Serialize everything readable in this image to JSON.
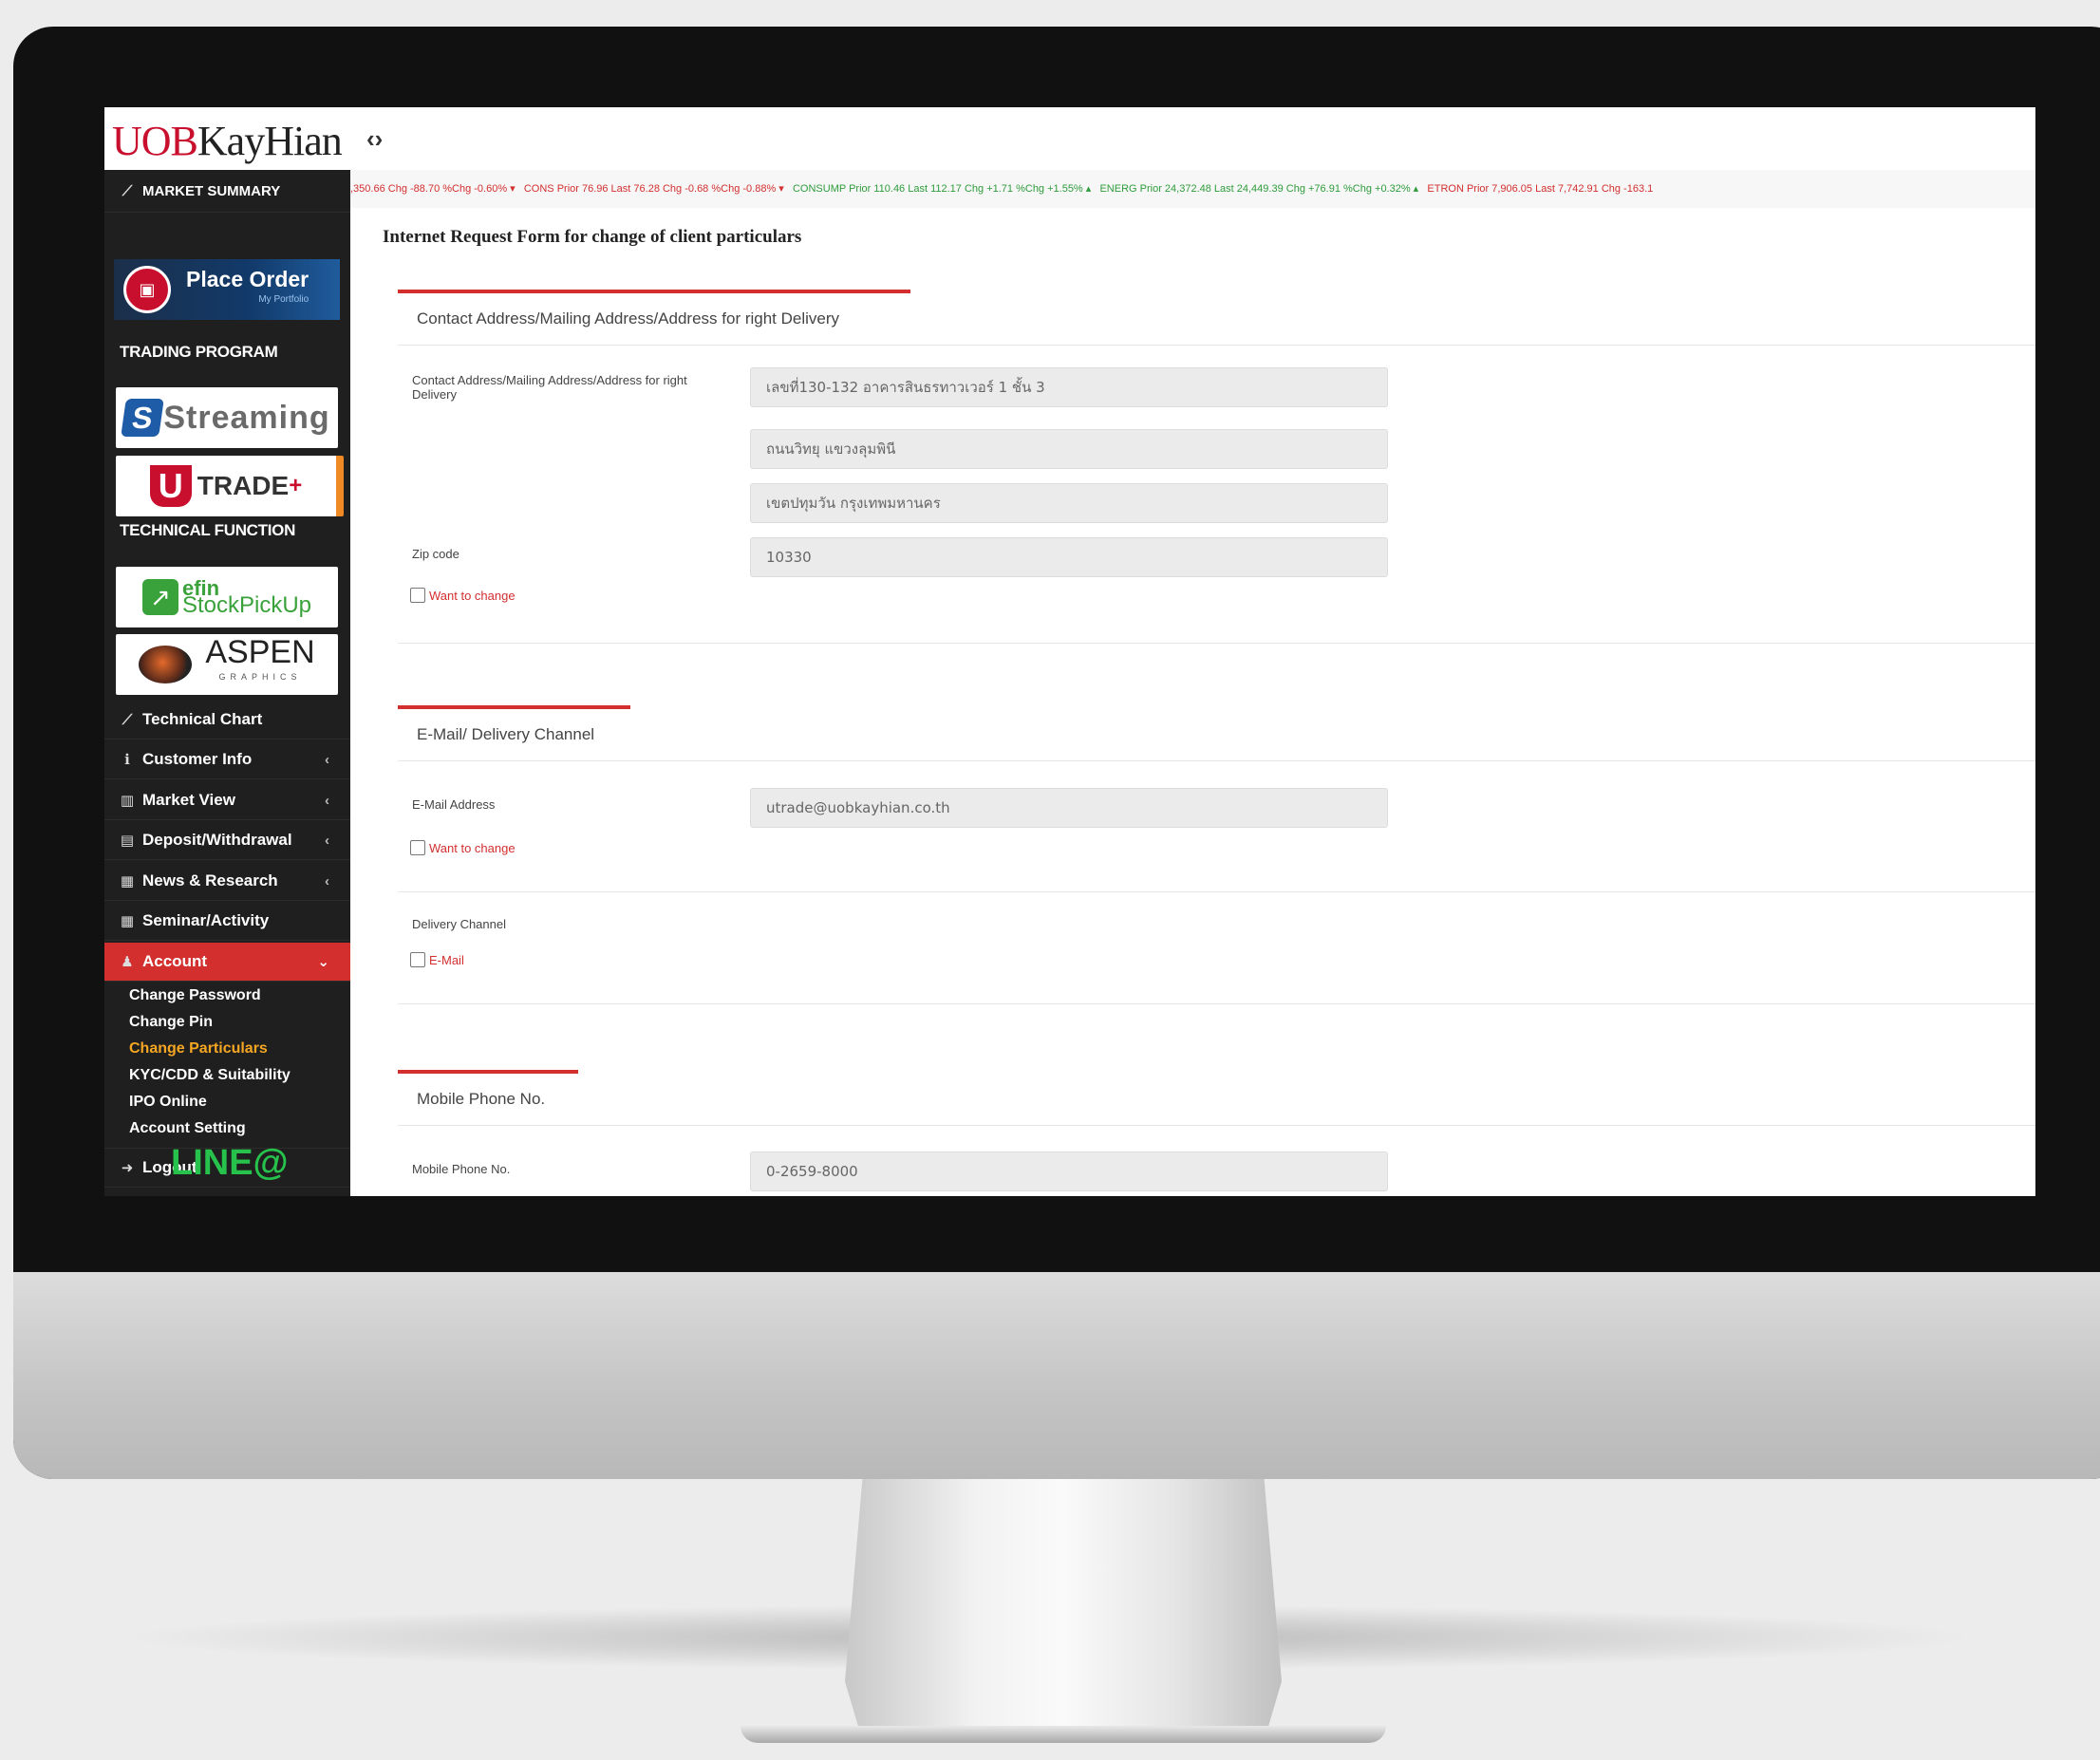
{
  "header": {
    "logo_uob": "UOB",
    "logo_kayhian": "KayHian",
    "toggle_icon": "code-brackets-icon"
  },
  "sidebar": {
    "market_summary": "MARKET SUMMARY",
    "place_order": {
      "title": "Place Order",
      "subtitle": "My Portfolio"
    },
    "trading_program": "TRADING PROGRAM",
    "streaming": "Streaming",
    "utrade": "TRADE",
    "technical_function": "TECHNICAL FUNCTION",
    "efin_top": "efin",
    "efin_bottom": "StockPickUp",
    "aspen": "ASPEN",
    "aspen_sub": "GRAPHICS",
    "items": [
      {
        "label": "Technical Chart"
      },
      {
        "label": "Customer Info"
      },
      {
        "label": "Market View"
      },
      {
        "label": "Deposit/Withdrawal"
      },
      {
        "label": "News & Research"
      },
      {
        "label": "Seminar/Activity"
      },
      {
        "label": "Account"
      }
    ],
    "account_sub": [
      "Change Password",
      "Change Pin",
      "Change Particulars",
      "KYC/CDD & Suitability",
      "IPO Online",
      "Account Setting"
    ],
    "logout": "Logout",
    "line": "LINE@"
  },
  "ticker": [
    {
      "text": ",350.66 Chg -88.70 %Chg -0.60% ▾",
      "dir": "dn"
    },
    {
      "text": "CONS Prior 76.96 Last 76.28 Chg -0.68 %Chg -0.88% ▾",
      "dir": "dn"
    },
    {
      "text": "CONSUMP Prior 110.46 Last 112.17 Chg +1.71 %Chg +1.55% ▴",
      "dir": "up"
    },
    {
      "text": "ENERG Prior 24,372.48 Last 24,449.39 Chg +76.91 %Chg +0.32% ▴",
      "dir": "up"
    },
    {
      "text": "ETRON Prior 7,906.05 Last 7,742.91 Chg -163.1",
      "dir": "dn"
    }
  ],
  "form": {
    "title": "Internet Request Form for change of client particulars",
    "sec_address": "Contact Address/Mailing Address/Address for right Delivery",
    "address_label": "Contact Address/Mailing Address/Address for right Delivery",
    "address_line1": "เลขที่130-132 อาคารสินธรทาวเวอร์ 1 ชั้น 3",
    "address_line2": "ถนนวิทยุ แขวงลุมพินี",
    "address_line3": "เขตปทุมวัน กรุงเทพมหานคร",
    "zip_label": "Zip code",
    "zip_value": "10330",
    "want_change": "Want to change",
    "sec_email": "E-Mail/ Delivery Channel",
    "email_label": "E-Mail Address",
    "email_value": "utrade@uobkayhian.co.th",
    "delivery_label": "Delivery Channel",
    "delivery_option": "E-Mail",
    "sec_mobile": "Mobile Phone No.",
    "mobile_label": "Mobile Phone No.",
    "mobile_value": "0-2659-8000"
  }
}
